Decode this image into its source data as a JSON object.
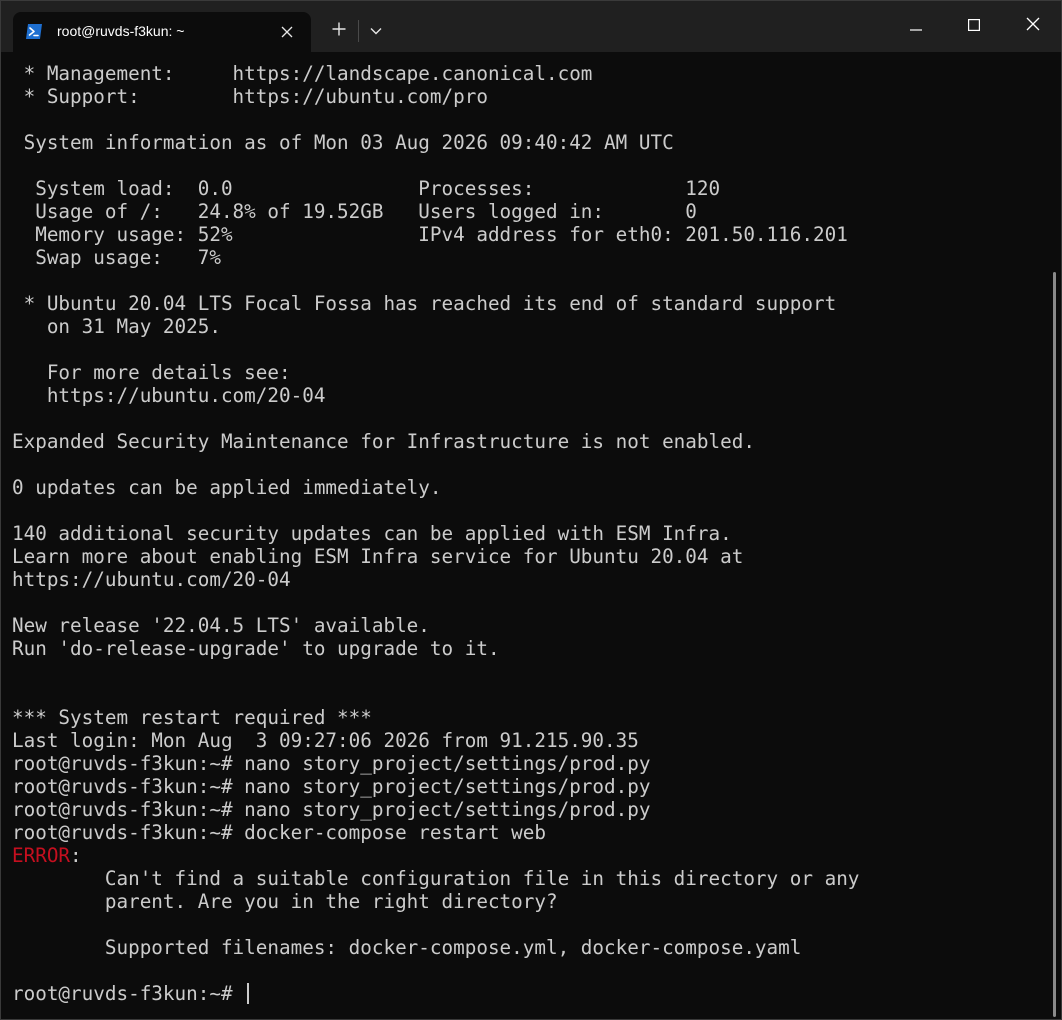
{
  "window": {
    "tab_title": "root@ruvds-f3kun: ~",
    "icons": {
      "tab": "powershell-icon",
      "close_tab": "close-icon",
      "new_tab": "plus-icon",
      "dropdown": "chevron-down-icon",
      "minimize": "minimize-icon",
      "maximize": "maximize-icon",
      "close": "close-icon"
    },
    "colors": {
      "titlebar": "#202020",
      "background": "#0c0c0c",
      "text": "#cccccc",
      "error": "#c50f1f",
      "icon_accent": "#1e6fd0"
    }
  },
  "terminal": {
    "lines": [
      " * Management:     https://landscape.canonical.com",
      " * Support:        https://ubuntu.com/pro",
      "",
      " System information as of Mon 03 Aug 2026 09:40:42 AM UTC",
      "",
      "  System load:  0.0                Processes:             120",
      "  Usage of /:   24.8% of 19.52GB   Users logged in:       0",
      "  Memory usage: 52%                IPv4 address for eth0: 201.50.116.201",
      "  Swap usage:   7%",
      "",
      " * Ubuntu 20.04 LTS Focal Fossa has reached its end of standard support",
      "   on 31 May 2025.",
      "",
      "   For more details see:",
      "   https://ubuntu.com/20-04",
      "",
      "Expanded Security Maintenance for Infrastructure is not enabled.",
      "",
      "0 updates can be applied immediately.",
      "",
      "140 additional security updates can be applied with ESM Infra.",
      "Learn more about enabling ESM Infra service for Ubuntu 20.04 at",
      "https://ubuntu.com/20-04",
      "",
      "New release '22.04.5 LTS' available.",
      "Run 'do-release-upgrade' to upgrade to it.",
      "",
      "",
      "*** System restart required ***",
      "Last login: Mon Aug  3 09:27:06 2026 from 91.215.90.35",
      "root@ruvds-f3kun:~# nano story_project/settings/prod.py",
      "root@ruvds-f3kun:~# nano story_project/settings/prod.py",
      "root@ruvds-f3kun:~# nano story_project/settings/prod.py",
      "root@ruvds-f3kun:~# docker-compose restart web"
    ],
    "error_label": "ERROR",
    "error_colon": ":",
    "error_lines": [
      "        Can't find a suitable configuration file in this directory or any",
      "        parent. Are you in the right directory?",
      "",
      "        Supported filenames: docker-compose.yml, docker-compose.yaml",
      ""
    ],
    "prompt": "root@ruvds-f3kun:~# "
  }
}
